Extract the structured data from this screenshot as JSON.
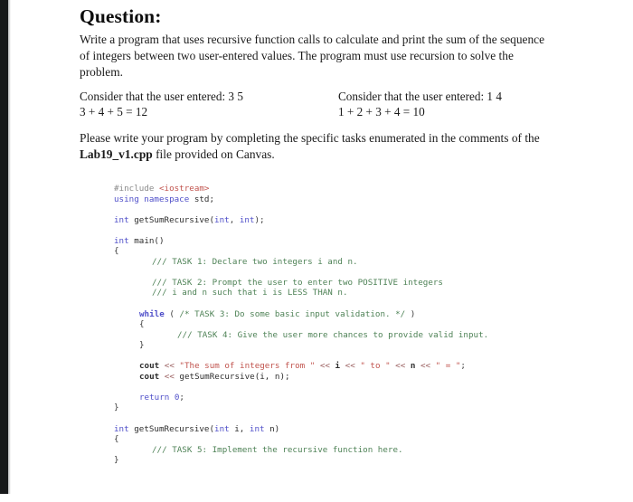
{
  "document": {
    "heading": "Question:",
    "intro": "Write a program that uses recursive function calls to calculate and print the sum of the sequence of integers between two user-entered values.  The program must use recursion to solve the problem.",
    "examples": [
      {
        "prompt": "Consider that the user entered: 3 5",
        "equation": "3 + 4  + 5 = 12"
      },
      {
        "prompt": "Consider that the user entered: 1 4",
        "equation": "1 + 2 + 3 + 4 = 10"
      }
    ],
    "closing_before": "Please write your program by completing the specific tasks enumerated in the comments of the ",
    "closing_filename": "Lab19_v1.cpp",
    "closing_after": " file provided on Canvas."
  },
  "code": {
    "language": "cpp",
    "colors": {
      "keyword": "#4f4fc9",
      "preprocessor": "#8a8a8a",
      "header": "#c1544e",
      "string": "#c1544e",
      "comment": "#4e8256",
      "identifier": "#2d2d2d",
      "operator": "#9a5f5f"
    },
    "lines": {
      "l01_pre": "#include ",
      "l01_hdr": "<iostream>",
      "l02_kw": "using namespace ",
      "l02_id": "std;",
      "l04_kw": "int ",
      "l04_id": "getSumRecursive(",
      "l04_kw2": "int",
      "l04_p1": ", ",
      "l04_kw3": "int",
      "l04_p2": ");",
      "l06_kw": "int ",
      "l06_id": "main()",
      "l07": "{",
      "l08_cmt": "/// TASK 1: Declare two integers i and n.",
      "l10_cmt": "/// TASK 2: Prompt the user to enter two POSITIVE integers",
      "l11_cmt": "/// i and n such that i is LESS THAN n.",
      "l13_kw": "while",
      "l13_p1": " ( ",
      "l13_cmt": "/* TASK 3: Do some basic input validation. */",
      "l13_p2": " )",
      "l14": "{",
      "l15_cmt": "/// TASK 4: Give the user more chances to provide valid input.",
      "l16": "}",
      "l18_id": "cout ",
      "l18_op1": "<< ",
      "l18_s1": "\"The sum of integers from \"",
      "l18_op2": " << ",
      "l18_v1": "i",
      "l18_op3": " << ",
      "l18_s2": "\" to \"",
      "l18_op4": " << ",
      "l18_v2": "n",
      "l18_op5": " << ",
      "l18_s3": "\" = \"",
      "l18_end": ";",
      "l19_id": "cout ",
      "l19_op": "<< ",
      "l19_call": "getSumRecursive(i, n);",
      "l21_kw": "return ",
      "l21_num": "0",
      "l21_end": ";",
      "l22": "}",
      "l24_kw": "int ",
      "l24_id": "getSumRecursive(",
      "l24_kw2": "int",
      "l24_a1": " i, ",
      "l24_kw3": "int",
      "l24_a2": " n)",
      "l25": "{",
      "l26_cmt": "/// TASK 5: Implement the recursive function here.",
      "l27": "}"
    }
  }
}
